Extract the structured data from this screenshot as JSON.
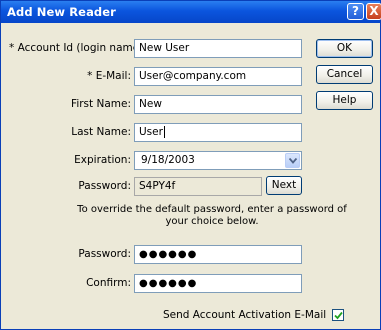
{
  "window": {
    "title": "Add New Reader",
    "help_glyph": "?",
    "close_glyph": "X"
  },
  "form": {
    "account_id": {
      "label": "* Account Id (login name):",
      "value": "New User"
    },
    "email": {
      "label": "* E-Mail:",
      "value": "User@company.com"
    },
    "first_name": {
      "label": "First Name:",
      "value": "New"
    },
    "last_name": {
      "label": "Last Name:",
      "value": "User"
    },
    "expiration": {
      "label": "Expiration:",
      "value": "9/18/2003"
    },
    "default_password": {
      "label": "Password:",
      "value": "S4PY4f"
    },
    "note_line1": "To override the default password, enter a password of",
    "note_line2": "your choice below.",
    "password": {
      "label": "Password:",
      "value": "●●●●●●"
    },
    "confirm": {
      "label": "Confirm:",
      "value": "●●●●●●"
    },
    "activation": {
      "label": "Send Account Activation E-Mail",
      "checked": true
    }
  },
  "buttons": {
    "ok": "OK",
    "cancel": "Cancel",
    "help": "Help",
    "next": "Next"
  },
  "icons": {
    "help": "help-icon",
    "close": "close-icon",
    "dropdown": "chevron-down-icon",
    "check": "checkmark-icon"
  }
}
